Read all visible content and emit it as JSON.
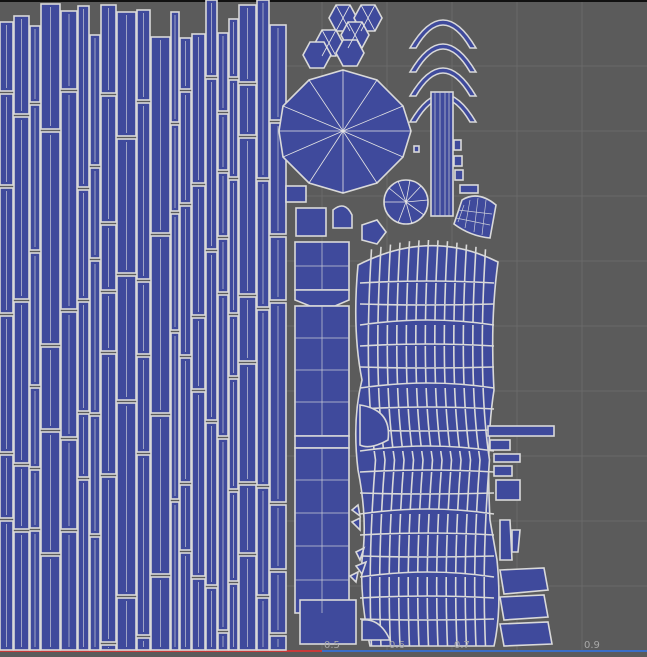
{
  "colors": {
    "background": "#5b5b5b",
    "grid": "#6a6a6a",
    "island_fill": "#3f4a9c",
    "island_edge": "#d9d9d9",
    "axis_u": "#c83a3a",
    "axis_v": "#3a6ec8"
  },
  "axis_ticks": [
    {
      "label": "0.5"
    },
    {
      "label": "0.6"
    },
    {
      "label": "0.7"
    },
    {
      "label": "0.9"
    }
  ]
}
